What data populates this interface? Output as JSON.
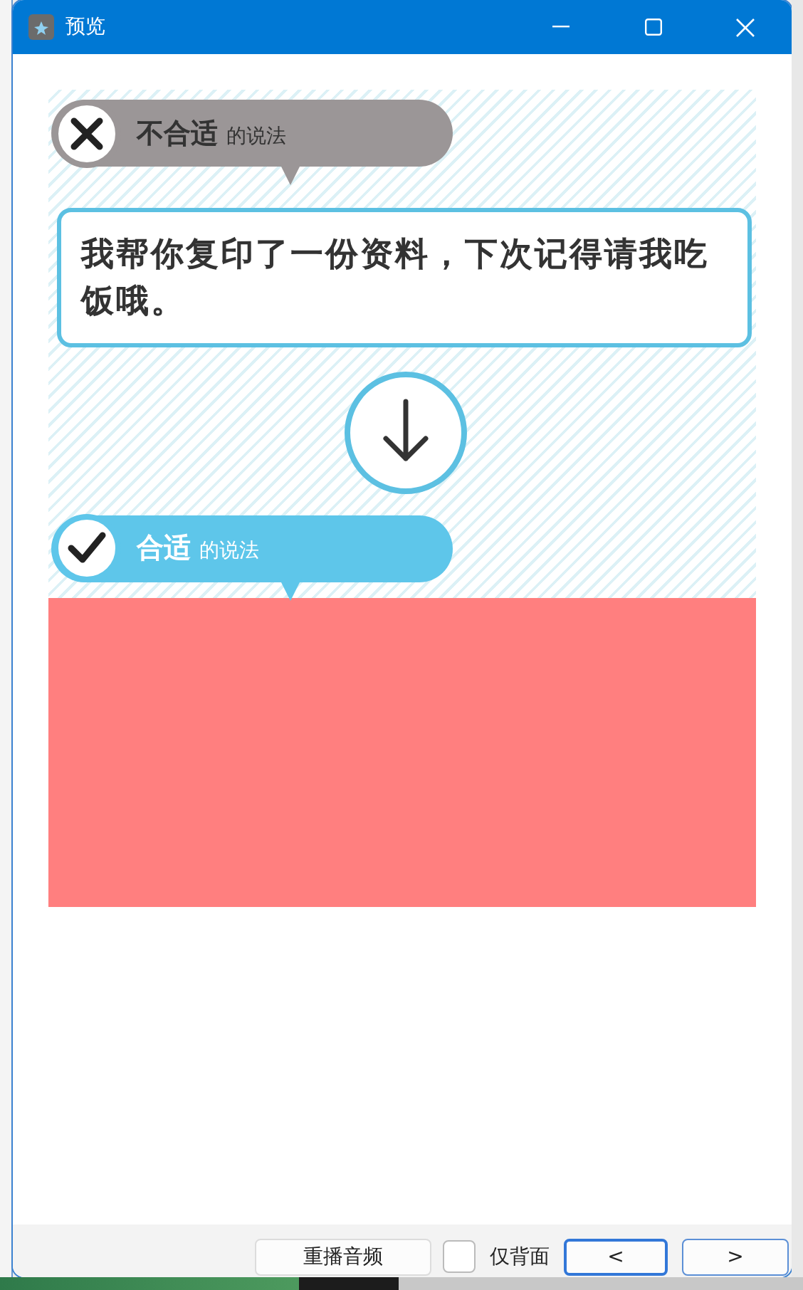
{
  "window": {
    "title": "预览"
  },
  "card": {
    "labels": [
      {
        "kind": "wrong",
        "title": "不合适",
        "suffix": "的说法"
      },
      {
        "kind": "right",
        "title": "合适",
        "suffix": "的说法"
      }
    ],
    "sentence": "我帮你复印了一份资料，下次记得请我吃饭哦。"
  },
  "toolbar": {
    "replay_button": "重播音频",
    "back_only": {
      "label": "仅背面",
      "checked": false
    },
    "nav_buttons": [
      {
        "label": "<",
        "focused": true
      },
      {
        "label": ">",
        "focused": false
      }
    ]
  }
}
